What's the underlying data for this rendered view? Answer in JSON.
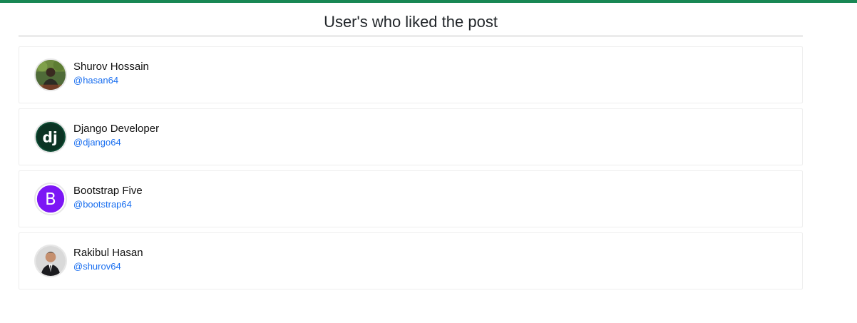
{
  "colors": {
    "accent": "#198754",
    "link": "#1a6ff0",
    "django": "#0c4b33",
    "bootstrap": "#7c16f5"
  },
  "header": {
    "title": "User's who liked the post"
  },
  "users": [
    {
      "name": "Shurov Hossain",
      "handle": "@hasan64",
      "avatar_icon": "person-photo-avatar"
    },
    {
      "name": "Django Developer",
      "handle": "@django64",
      "avatar_icon": "django-logo",
      "avatar_text": "dj"
    },
    {
      "name": "Bootstrap Five",
      "handle": "@bootstrap64",
      "avatar_icon": "bootstrap-logo",
      "avatar_text": "B"
    },
    {
      "name": "Rakibul Hasan",
      "handle": "@shurov64",
      "avatar_icon": "person-photo-avatar"
    }
  ]
}
